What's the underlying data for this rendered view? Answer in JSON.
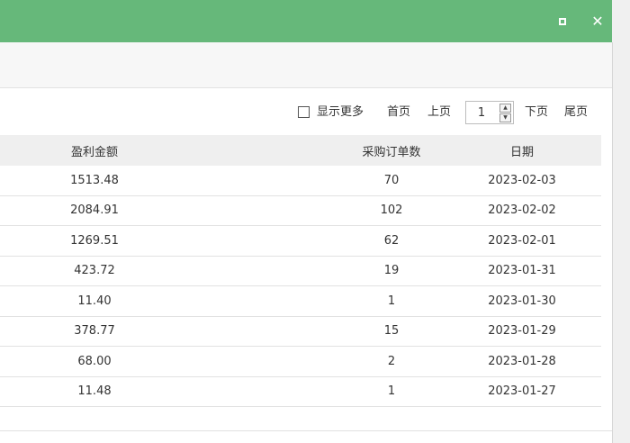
{
  "window": {
    "titlebar_color": "#66b87a",
    "maximize_icon": "maximize-icon",
    "close_icon": "close-icon",
    "close_glyph": "✕"
  },
  "pager": {
    "show_more_label": "显示更多",
    "show_more_checked": false,
    "first_label": "首页",
    "prev_label": "上页",
    "page_value": "1",
    "next_label": "下页",
    "last_label": "尾页"
  },
  "table": {
    "columns": [
      "盈利金额",
      "采购订单数",
      "日期"
    ],
    "rows": [
      {
        "profit": "1513.48",
        "orders": "70",
        "date": "2023-02-03"
      },
      {
        "profit": "2084.91",
        "orders": "102",
        "date": "2023-02-02"
      },
      {
        "profit": "1269.51",
        "orders": "62",
        "date": "2023-02-01"
      },
      {
        "profit": "423.72",
        "orders": "19",
        "date": "2023-01-31"
      },
      {
        "profit": "11.40",
        "orders": "1",
        "date": "2023-01-30"
      },
      {
        "profit": "378.77",
        "orders": "15",
        "date": "2023-01-29"
      },
      {
        "profit": "68.00",
        "orders": "2",
        "date": "2023-01-28"
      },
      {
        "profit": "11.48",
        "orders": "1",
        "date": "2023-01-27"
      }
    ]
  }
}
